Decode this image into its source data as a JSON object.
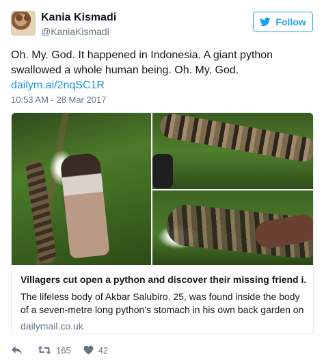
{
  "user": {
    "name": "Kania Kismadi",
    "handle": "@KaniaKismadi"
  },
  "follow_button": {
    "label": "Follow",
    "icon": "twitter-bird-icon",
    "color": "#1da1f2"
  },
  "tweet": {
    "text": "Oh. My. God. It happened in Indonesia. A giant python swallowed a whole human being. Oh. My. God.",
    "link": "dailym.ai/2nqSC1R",
    "timestamp": "10:53 AM - 28 Mar 2017"
  },
  "card": {
    "title": "Villagers cut open a python and discover their missing friend i...",
    "description": "The lifeless body of Akbar Salubiro, 25, was found inside the body of a seven-metre long python's stomach in his own back garden on the",
    "domain": "dailymail.co.uk"
  },
  "actions": {
    "reply_icon": "reply-icon",
    "retweet_icon": "retweet-icon",
    "retweet_count": "165",
    "like_icon": "heart-icon",
    "like_count": "42"
  },
  "colors": {
    "link": "#1b95e0",
    "secondary_text": "#657786",
    "border": "#e1e8ed"
  }
}
